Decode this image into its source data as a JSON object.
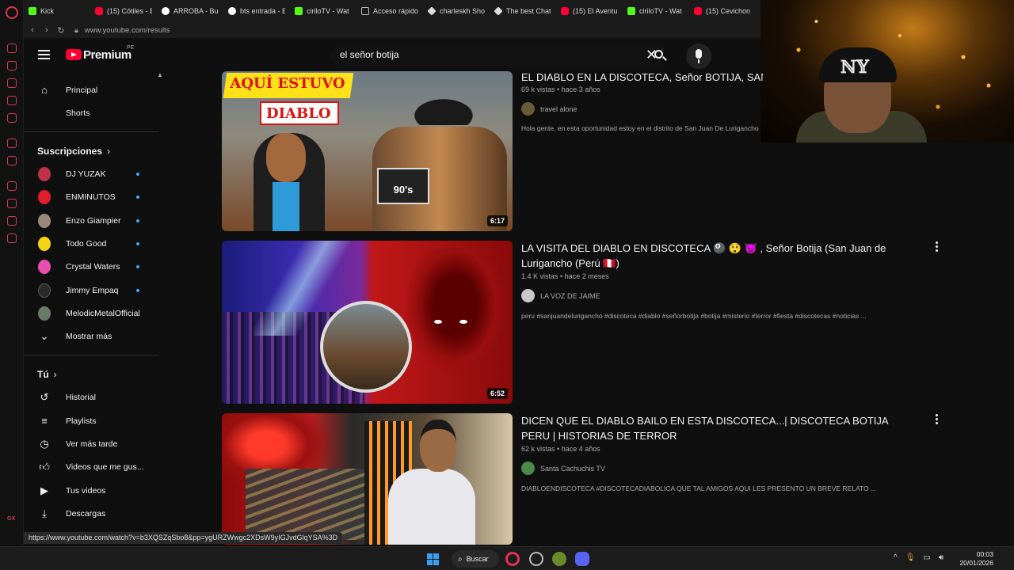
{
  "browser": {
    "tabs": [
      {
        "icon": "kick",
        "label": "Kick"
      },
      {
        "icon": "youtube",
        "label": "(15) Cótiles - E"
      },
      {
        "icon": "google",
        "label": "ARROBA - Bus"
      },
      {
        "icon": "google",
        "label": "bts entrada - E"
      },
      {
        "icon": "kick",
        "label": "ciriloTV - Wat"
      },
      {
        "icon": "grid",
        "label": "Acceso rápido"
      },
      {
        "icon": "diamond",
        "label": "charleskh Sho"
      },
      {
        "icon": "diamond",
        "label": "The best Chat"
      },
      {
        "icon": "youtube",
        "label": "(15) El Aventur"
      },
      {
        "icon": "kick",
        "label": "ciriloTV - Wat"
      },
      {
        "icon": "youtube",
        "label": "(15) Cevichon"
      }
    ],
    "address": "www.youtube.com/results",
    "status_url": "https://www.youtube.com/watch?v=b3XQSZqSbo8&pp=ygURZWwgc2XDsW9yIGJvdGlqYSA%3D"
  },
  "header": {
    "brand": "Premium",
    "region": "PE",
    "search_query": "el señor botija"
  },
  "sidebar": {
    "main": [
      {
        "icon": "home-icon",
        "label": "Principal"
      },
      {
        "icon": "shorts-icon",
        "label": "Shorts"
      }
    ],
    "subscriptions_title": "Suscripciones",
    "subscriptions": [
      {
        "label": "DJ YUZAK",
        "color": "#c0314a",
        "new": true
      },
      {
        "label": "ENMINUTOS",
        "color": "#e11d2c",
        "new": true
      },
      {
        "label": "Enzo Giampier",
        "color": "#9a8a7a",
        "new": true
      },
      {
        "label": "Todo Good",
        "color": "#f5d415",
        "new": true
      },
      {
        "label": "Crystal Waters",
        "color": "#e84fb0",
        "new": true
      },
      {
        "label": "Jimmy Empaq",
        "color": "#2a2a2a",
        "new": true
      },
      {
        "label": "MelodicMetalOfficial",
        "color": "#6a7a6a",
        "new": false
      }
    ],
    "show_more": "Mostrar más",
    "you_title": "Tú",
    "you_items": [
      {
        "icon": "history-icon",
        "label": "Historial"
      },
      {
        "icon": "playlists-icon",
        "label": "Playlists"
      },
      {
        "icon": "clock-icon",
        "label": "Ver más tarde"
      },
      {
        "icon": "like-icon",
        "label": "Videos que me gus..."
      },
      {
        "icon": "your-videos-icon",
        "label": "Tus videos"
      },
      {
        "icon": "download-icon",
        "label": "Descargas"
      }
    ]
  },
  "results": [
    {
      "title": "EL DIABLO EN LA DISCOTECA, Señor BOTIJA, SAN J",
      "views": "69 k vistas",
      "age": "hace 3 años",
      "channel": "travel alone",
      "channel_color": "#6a5a3a",
      "description": "Hola gente, en esta oportunidad estoy en el distrito de San Juan De Lurigancho",
      "duration": "6:17",
      "thumb_texts": [
        "AQUÍ ESTUVO",
        "DIABLO",
        "90's"
      ]
    },
    {
      "title": "LA VISITA DEL DIABLO EN DISCOTECA 🎱 😲 👿 , Señor Botija (San Juan de Lurigancho (Perú 🇵🇪)",
      "views": "1.4 K vistas",
      "age": "hace 2 meses",
      "channel": "LA VOZ DE JAIME",
      "channel_color": "#c8c8c8",
      "description": "peru #sanjuandelurigancho #discoteca #diablo #señorbotija #botija #misterio #terror #fiesta #discotecas #noticias ...",
      "duration": "6:52"
    },
    {
      "title": "DICEN QUE EL DIABLO BAILO EN ESTA DISCOTECA...| DISCOTECA BOTIJA PERU | HISTORIAS DE TERROR",
      "views": "62 k vistas",
      "age": "hace 4 años",
      "channel": "Santa Cachuchis TV",
      "channel_color": "#4a8a4a",
      "description": "DIABLOENDISCOTECA #DISCOTECADIABOLICA QUE TAL AMIGOS AQUI LES PRESENTO UN BREVE RELATO ..."
    }
  ],
  "taskbar": {
    "search_label": "Buscar",
    "time": "00:03",
    "date": "20/01/2026"
  }
}
